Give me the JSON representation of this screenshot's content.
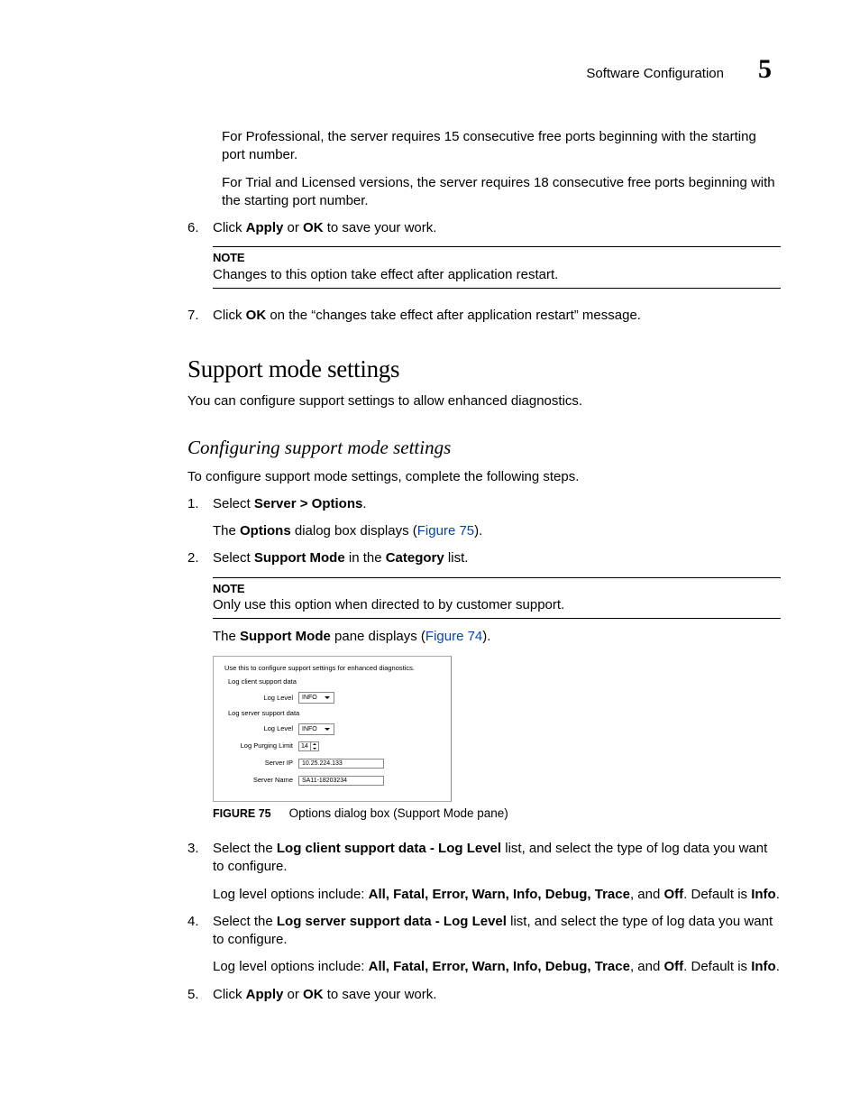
{
  "header": {
    "title": "Software Configuration",
    "chapter": "5"
  },
  "intro_paras": [
    "For Professional, the server requires 15 consecutive free ports beginning with the starting port number.",
    "For Trial and Licensed versions, the server requires 18 consecutive free ports beginning with the starting port number."
  ],
  "step6": {
    "num": "6.",
    "pre": "Click ",
    "b1": "Apply",
    "mid": " or ",
    "b2": "OK",
    "post": " to save your work."
  },
  "note1": {
    "title": "NOTE",
    "text": "Changes to this option take effect after application restart."
  },
  "step7": {
    "num": "7.",
    "pre": "Click ",
    "b1": "OK",
    "post": " on the “changes take effect after application restart” message."
  },
  "section_title": "Support mode settings",
  "section_intro": "You can configure support settings to allow enhanced diagnostics.",
  "subsection_title": "Configuring support mode settings",
  "subsection_intro": "To configure support mode settings, complete the following steps.",
  "step1": {
    "num": "1.",
    "pre": "Select ",
    "b1": "Server > Options",
    "post": ".",
    "p2_pre": "The ",
    "p2_b": "Options",
    "p2_mid": " dialog box displays (",
    "p2_link": "Figure 75",
    "p2_post": ")."
  },
  "step2": {
    "num": "2.",
    "pre": "Select ",
    "b1": "Support Mode",
    "mid": " in the ",
    "b2": "Category",
    "post": " list."
  },
  "note2": {
    "title": "NOTE",
    "text": "Only use this option when directed to by customer support."
  },
  "after_note2_pre": "The ",
  "after_note2_b": "Support Mode",
  "after_note2_mid": " pane displays (",
  "after_note2_link": "Figure 74",
  "after_note2_post": ").",
  "dialog": {
    "desc": "Use this to configure support settings for enhanced diagnostics.",
    "group1": "Log client support data",
    "loglevel_label": "Log Level",
    "loglevel_val": "INFO",
    "group2": "Log server support data",
    "purging_label": "Log Purging Limit",
    "purging_val": "14",
    "serverip_label": "Server IP",
    "serverip_val": "10.25.224.133",
    "servername_label": "Server Name",
    "servername_val": "SA11-18203234"
  },
  "figure_caption": {
    "label": "FIGURE 75",
    "text": "Options dialog box (Support Mode pane)"
  },
  "step3": {
    "num": "3.",
    "pre": "Select the ",
    "b1": "Log client support data - Log Level",
    "post": " list, and select the type of log data you want to configure.",
    "p2_pre": "Log level options include: ",
    "opts": "All, Fatal, Error, Warn, Info, Debug, Trace",
    "p2_mid1": ", and ",
    "opt_off": "Off",
    "p2_mid2": ". Default is ",
    "opt_def": "Info",
    "p2_post": "."
  },
  "step4": {
    "num": "4.",
    "pre": "Select the ",
    "b1": "Log server support data - Log Level",
    "post": " list, and select the type of log data you want to configure.",
    "p2_pre": "Log level options include: ",
    "opts": "All, Fatal, Error, Warn, Info, Debug, Trace",
    "p2_mid1": ", and ",
    "opt_off": "Off",
    "p2_mid2": ". Default is ",
    "opt_def": "Info",
    "p2_post": "."
  },
  "step5": {
    "num": "5.",
    "pre": "Click ",
    "b1": "Apply",
    "mid": " or ",
    "b2": "OK",
    "post": " to save your work."
  }
}
